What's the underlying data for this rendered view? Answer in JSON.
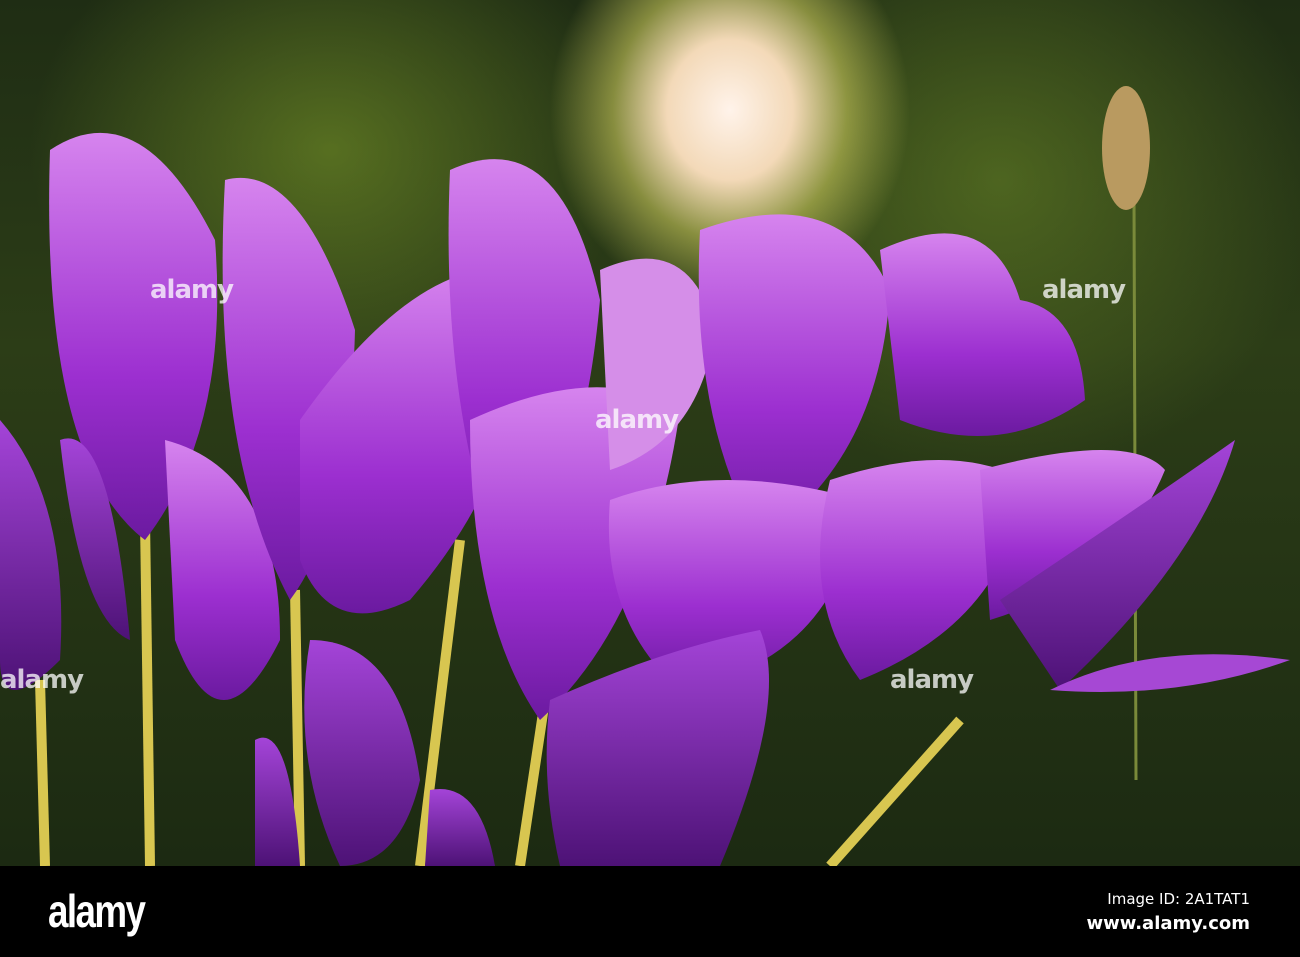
{
  "photo": {
    "subject": "purple-crocus-flowers",
    "watermark": "alamy"
  },
  "footer": {
    "logo": "alamy",
    "image_id": "Image ID: 2A1TAT1",
    "url": "www.alamy.com"
  },
  "colors": {
    "petal": "#a437d6",
    "petal_light": "#d27ee8",
    "stem": "#d6c34a",
    "background": "#2c3d17"
  }
}
